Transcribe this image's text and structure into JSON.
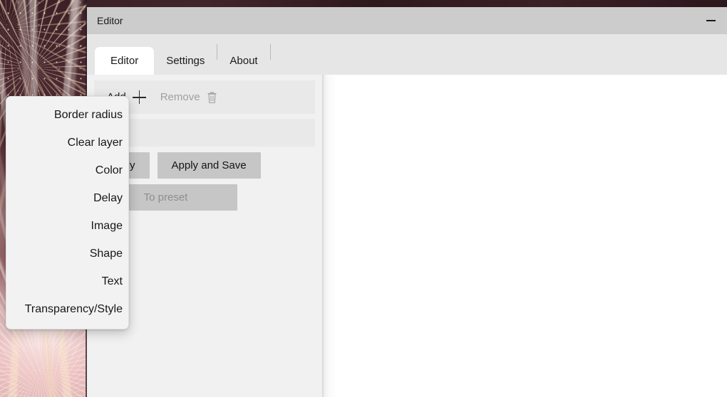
{
  "window": {
    "title": "Editor",
    "minimize_label": "minimize"
  },
  "tabs": [
    {
      "label": "Editor",
      "active": true
    },
    {
      "label": "Settings",
      "active": false
    },
    {
      "label": "About",
      "active": false
    }
  ],
  "toolbar": {
    "add_label": "Add",
    "add_icon": "plus-icon",
    "remove_label": "Remove",
    "remove_icon": "trash-icon"
  },
  "actions": {
    "apply_label": "Apply",
    "apply_and_save_label": "Apply and Save",
    "to_preset_label": "To preset"
  },
  "context_menu": {
    "items": [
      {
        "label": "Border radius"
      },
      {
        "label": "Clear layer"
      },
      {
        "label": "Color"
      },
      {
        "label": "Delay"
      },
      {
        "label": "Image"
      },
      {
        "label": "Shape"
      },
      {
        "label": "Text"
      },
      {
        "label": "Transparency/Style"
      }
    ]
  },
  "colors": {
    "titlebar": "#cccccc",
    "tabstrip": "#e6e6e6",
    "panel": "#f1f1f1",
    "toolbar": "#e9e9e9",
    "button": "#c6c6c6",
    "menu": "#f2f2f2",
    "canvas": "#ffffff",
    "desktop": "#2e1a20"
  }
}
